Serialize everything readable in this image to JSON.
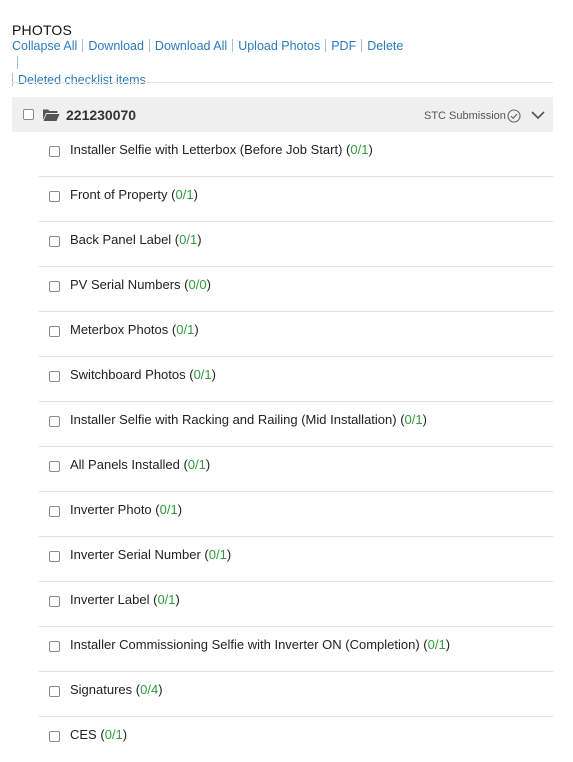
{
  "section_title": "PHOTOS",
  "actions": {
    "collapse_all": "Collapse All",
    "download": "Download",
    "download_all": "Download All",
    "upload_photos": "Upload Photos",
    "pdf": "PDF",
    "delete": "Delete",
    "deleted_checklist_items": "Deleted checklist items"
  },
  "group": {
    "id": "221230070",
    "status_label": "STC Submission",
    "icons": [
      "folder-icon",
      "check-circle-icon",
      "chevron-down-icon"
    ]
  },
  "count_color": "#2e9c3a",
  "link_color": "#2b7bbf",
  "items": [
    {
      "label": "Installer Selfie with Letterbox (Before Job Start)",
      "count": "0/1"
    },
    {
      "label": "Front of Property",
      "count": "0/1"
    },
    {
      "label": "Back Panel Label",
      "count": "0/1"
    },
    {
      "label": "PV Serial Numbers",
      "count": "0/0"
    },
    {
      "label": "Meterbox Photos",
      "count": "0/1"
    },
    {
      "label": "Switchboard Photos",
      "count": "0/1"
    },
    {
      "label": "Installer Selfie with Racking and Railing (Mid Installation)",
      "count": "0/1"
    },
    {
      "label": "All Panels Installed",
      "count": "0/1"
    },
    {
      "label": "Inverter Photo",
      "count": "0/1"
    },
    {
      "label": "Inverter Serial Number",
      "count": "0/1"
    },
    {
      "label": "Inverter Label",
      "count": "0/1"
    },
    {
      "label": "Installer Commissioning Selfie with Inverter ON (Completion)",
      "count": "0/1"
    },
    {
      "label": "Signatures",
      "count": "0/4"
    },
    {
      "label": "CES",
      "count": "0/1"
    }
  ]
}
